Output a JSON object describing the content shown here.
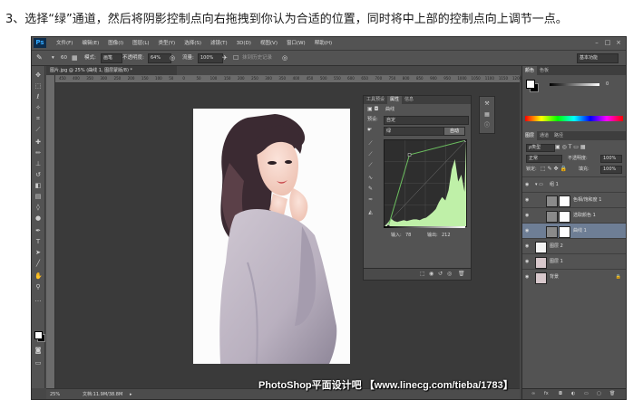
{
  "caption": "3、选择“绿”通道，然后将阴影控制点向右拖拽到你认为合适的位置，同时将中上部的控制点向上调节一点。",
  "app": {
    "logo": "Ps",
    "menu": [
      "文件(F)",
      "编辑(E)",
      "图像(I)",
      "图层(L)",
      "类型(Y)",
      "选择(S)",
      "滤镜(T)",
      "3D(D)",
      "视图(V)",
      "窗口(W)",
      "帮助(H)"
    ],
    "window_controls": [
      "minimize-icon",
      "maximize-icon",
      "close-icon"
    ]
  },
  "options_bar": {
    "size": "60",
    "mode_label": "模式:",
    "mode_value": "画笔",
    "opacity_label": "不透明度:",
    "opacity_value": "64%",
    "flow_label": "流量:",
    "flow_value": "100%",
    "history_label": "抹到历史记录",
    "workspace": "基本功能"
  },
  "document": {
    "tab_title": "图片.jpg @ 25% (曲线 1, 图层蒙版/8) *",
    "ruler_ticks": [
      "450",
      "400",
      "350",
      "300",
      "250",
      "200",
      "150",
      "100",
      "50",
      "0",
      "50",
      "100",
      "150",
      "200",
      "250",
      "300",
      "350",
      "400",
      "450",
      "500",
      "550",
      "600",
      "650",
      "700",
      "750",
      "800",
      "850",
      "900",
      "950",
      "1000",
      "1050",
      "1100",
      "1150",
      "1200"
    ],
    "zoom": "25%",
    "doc_size": "文档:11.9M/38.8M",
    "watermark": "PhotoShop平面设计吧 【www.linecg.com/tieba/1783】"
  },
  "properties": {
    "tabs": [
      "工具预设",
      "属性",
      "信息"
    ],
    "active_tab": 1,
    "title": "曲线",
    "preset_label": "预设:",
    "preset_value": "自定",
    "channel_value": "绿",
    "auto_button": "自动",
    "input_label": "输入:",
    "input_value": "78",
    "output_label": "输出:",
    "output_value": "212"
  },
  "curves_chart": {
    "type": "area",
    "x": [
      0,
      10,
      20,
      30,
      40,
      50,
      60,
      70,
      80,
      90,
      100,
      110,
      120,
      130,
      140,
      150,
      160,
      170,
      180,
      190,
      200,
      210,
      220,
      230,
      240,
      250,
      255
    ],
    "histogram": [
      0,
      4,
      9,
      6,
      5,
      6,
      7,
      6,
      7,
      8,
      8,
      7,
      9,
      10,
      13,
      16,
      20,
      28,
      34,
      30,
      42,
      66,
      78,
      52,
      60,
      40,
      100
    ],
    "curve_points": [
      [
        12,
        0
      ],
      [
        78,
        212
      ],
      [
        255,
        255
      ]
    ],
    "xlim": [
      0,
      255
    ],
    "ylim": [
      0,
      255
    ]
  },
  "panels": {
    "top_tabs": [
      "颜色",
      "色板"
    ],
    "slider_value": "0",
    "layers_tabs": [
      "图层",
      "通道",
      "路径"
    ],
    "kind_label": "ρ类型",
    "blend_mode": "正常",
    "opacity_label": "不透明度:",
    "opacity_value": "100%",
    "lock_label": "锁定:",
    "fill_label": "填充:",
    "fill_value": "100%",
    "layers": [
      {
        "name": "组 1",
        "type": "group",
        "selected": false
      },
      {
        "name": "色相/饱和度 1",
        "type": "adjust",
        "selected": false
      },
      {
        "name": "选取颜色 1",
        "type": "adjust",
        "selected": false
      },
      {
        "name": "曲线 1",
        "type": "adjust",
        "selected": true
      },
      {
        "name": "图层 2",
        "type": "pixel",
        "selected": false
      },
      {
        "name": "图层 1",
        "type": "pixel",
        "selected": false
      },
      {
        "name": "背景",
        "type": "pixel",
        "selected": false
      }
    ],
    "bottom_icons": [
      "link-icon",
      "fx-icon",
      "mask-icon",
      "adjustment-icon",
      "folder-icon",
      "new-layer-icon",
      "trash-icon"
    ]
  },
  "colors": {
    "ps_dark": "#474747",
    "panel": "#535353",
    "histogram_fill": "#bff0a8",
    "curve_line": "#6dc060",
    "selected_layer": "#6e7e95"
  }
}
